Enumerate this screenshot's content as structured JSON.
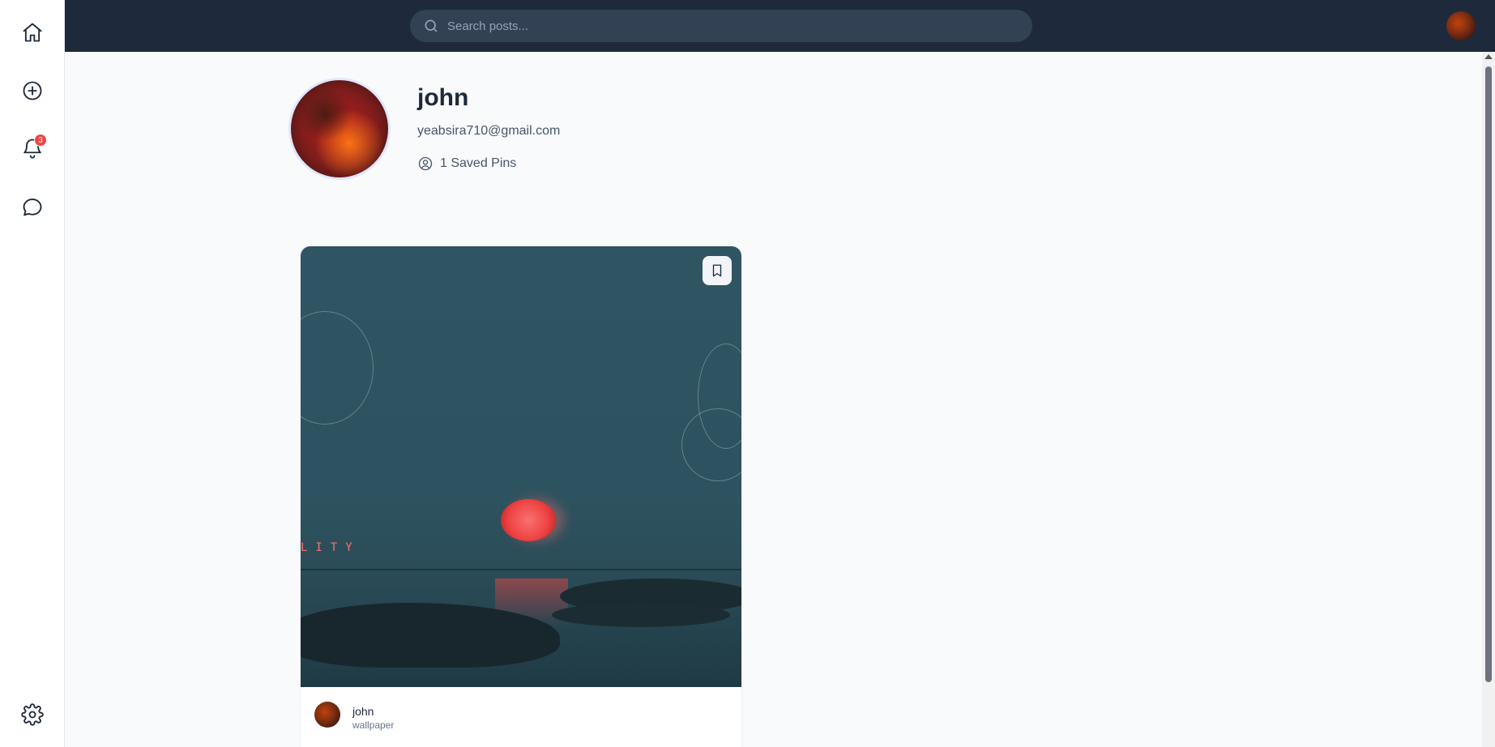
{
  "sidebar": {
    "items": [
      {
        "name": "home",
        "icon": "home-icon"
      },
      {
        "name": "create",
        "icon": "plus-circle-icon"
      },
      {
        "name": "notifications",
        "icon": "bell-icon",
        "badge": "3"
      },
      {
        "name": "messages",
        "icon": "chat-bubble-icon"
      },
      {
        "name": "settings",
        "icon": "gear-icon"
      }
    ]
  },
  "header": {
    "search_placeholder": "Search posts...",
    "avatar_icon": "user-avatar"
  },
  "profile": {
    "name": "john",
    "email": "yeabsira710@gmail.com",
    "saved_pins": "1 Saved Pins"
  },
  "pins": [
    {
      "author": "john",
      "category": "wallpaper",
      "image_text": "LITY"
    }
  ],
  "colors": {
    "topbar": "#1e293b",
    "search_bg": "#334155",
    "badge": "#ef4444",
    "page_bg": "#f8fafc"
  }
}
